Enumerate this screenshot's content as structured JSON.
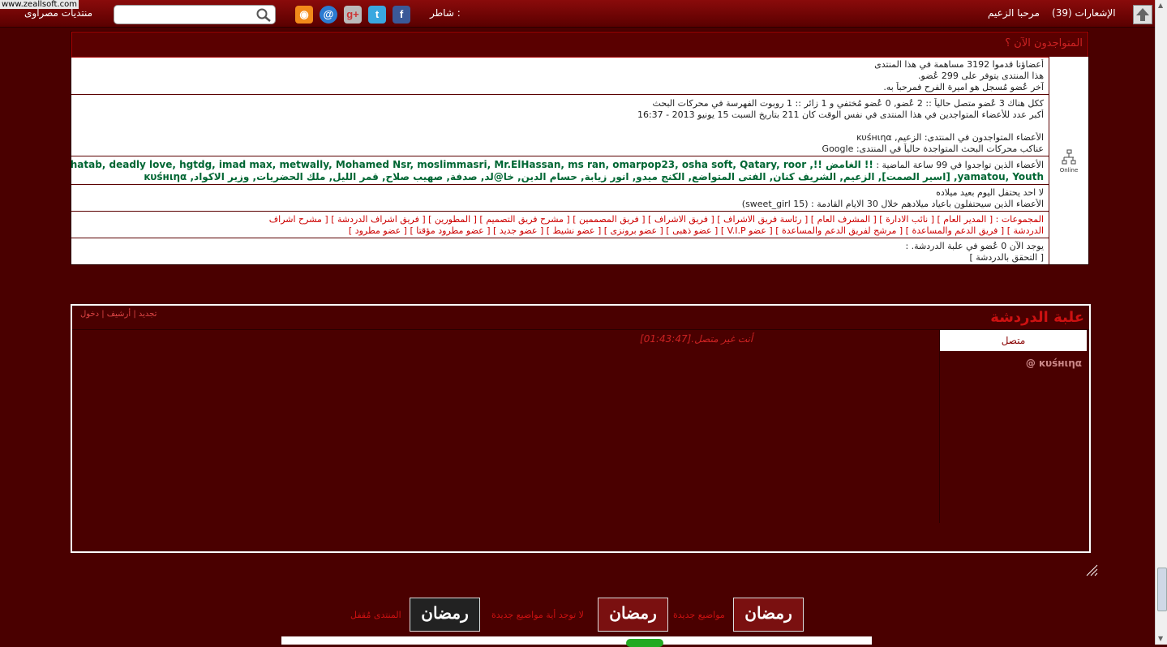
{
  "watermark": "www.zeallsoft.com",
  "topbar": {
    "site_name": "منتديات مصراوى",
    "share_label": "شاطر :",
    "welcome": "مرحبا الزعيم",
    "notifications_label": "الإشعارات (39)",
    "search_placeholder": ""
  },
  "who": {
    "title": "المتواجدون الآن ؟",
    "online_icon_label": "Online",
    "stats": [
      "أعضاؤنا قدموا 3192 مساهمة في هذا المنتدى",
      "هذا المنتدى يتوفر على 299 عُضو.",
      "آخر عُضو مُسجل هو اميرة الفرح فمرحباً به."
    ],
    "online": [
      "ككل هناك 3 عُضو متصل حالياً :: 2 عُضو, 0 عُضو مُختفي و 1 زائر :: 1 روبوت الفهرسة في محركات البحث",
      "أكبر عدد للأعضاء المتواجدين في هذا المنتدى في نفس الوقت كان 211 بتاريخ السبت 15 يونيو 2013 - 16:37",
      "",
      "الأعضاء المتواجدون في المنتدى: الزعيم, ĸυśнιηα",
      "عناكب محركات البحث المتواجدة حالياً في المنتدى: Google"
    ],
    "last99_prefix": "الأعضاء الذين تواجدوا في 99 ساعة الماضية :",
    "last99_line1": "!! الغامض !!, abohatab, deadly love, hgtdg, imad max, metwally, Mohamed Nsr, moslimmasri, Mr.ElHassan, ms ran, omarpop23, osha soft, Qatary, roor",
    "last99_line2": "yamatou, Youth, [اسير الصمت], الزعيم, الشريف كنان, الفتى المتواضع, الكنج ميدو, انور زيابة, حسام الدين, خا@لد, صدفة, صهيب صلاح, قمر الليل, ملك الحضريات, وزير الاكواد, ĸυśнιηα",
    "birthday_today": "لا احد يحتفل اليوم بعيد ميلاده",
    "birthday_upcoming": "الأعضاء الذين سيحتفلون باعياد ميلادهم خلال 30 الايام القادمة : (15 sweet_girl)",
    "groups_line1": "المجموعات : [ المدير العام ] [ نائب الادارة ] [ المشرف العام ] [ رئاسة فريق الاشراف ] [ فريق الاشراف ] [ فريق المصممين ] [ مشرح فريق التصميم ] [ المطورين ] [ فريق اشراف الدردشة ] [ مشرح اشراف",
    "groups_line2": "الدردشة ] [ فريق الدعم والمساعدة ] [ مرشح لفريق الدعم والمساعدة ] [ عضو V.I.P ] [ عضو ذهبى ] [ عضو برونزى ] [ عضو نشيط ] [ عضو جديد ] [ عضو مطرود مؤقتا ] [ عضو مطرود ]",
    "chat_count": "يوجد الآن 0 عُضو في علبة الدردشة. :",
    "chat_check": "[ التحقق بالدردشة ]"
  },
  "chat": {
    "title": "علبة الدردشة",
    "links": "تجديد | أرشيف | دخول",
    "message_time": "[01:43:47]",
    "message_text": "أنت غير متصل.",
    "tab_online": "متصل",
    "user": "@ ĸυśнιηα"
  },
  "legend": {
    "new_posts": "مواضيع جديدة",
    "no_new_posts": "لا توجد أية مواضيع جديدة",
    "locked": "المنتدى مُقفل",
    "tile_text": "رمضان"
  },
  "colors": {
    "accent": "#8b0000",
    "background": "#4a0000"
  }
}
